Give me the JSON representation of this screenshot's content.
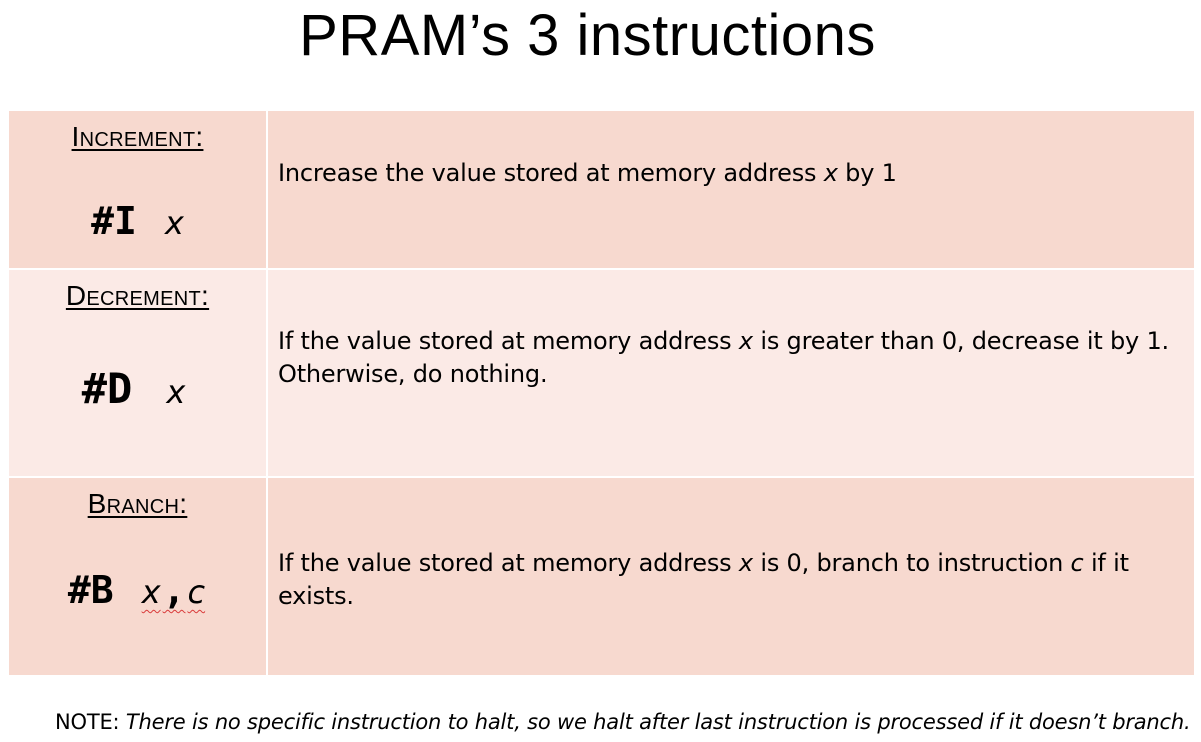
{
  "title": "PRAM’s 3 instructions",
  "instructions": [
    {
      "name": "Increment:",
      "opcode": "#I",
      "arg1": "x",
      "desc_line1": "Increase the value stored at memory address ",
      "desc_var": "x",
      "desc_line1_end": " by 1"
    },
    {
      "name": "Decrement:",
      "opcode": "#D",
      "arg1": "x",
      "desc_line1": "If the value stored at memory address ",
      "desc_var": "x",
      "desc_line1_end": " is greater than 0, decrease it by 1.",
      "desc_line2": "Otherwise, do nothing."
    },
    {
      "name": "Branch:",
      "opcode": "#B",
      "arg1": "x",
      "comma": ",",
      "arg2": "c",
      "desc_line1": "If the value stored at memory address ",
      "desc_var": "x",
      "desc_mid": " is 0, branch to instruction ",
      "desc_var2": "c",
      "desc_line1_end": " if it exists."
    }
  ],
  "note": {
    "label": "NOTE: ",
    "text": "There is no specific instruction to halt, so we halt after last instruction is processed if it doesn’t branch."
  },
  "colors": {
    "row_dark": "#f7d9cf",
    "row_light": "#fbeae6",
    "spellcheck_underline": "#d93a3a"
  }
}
